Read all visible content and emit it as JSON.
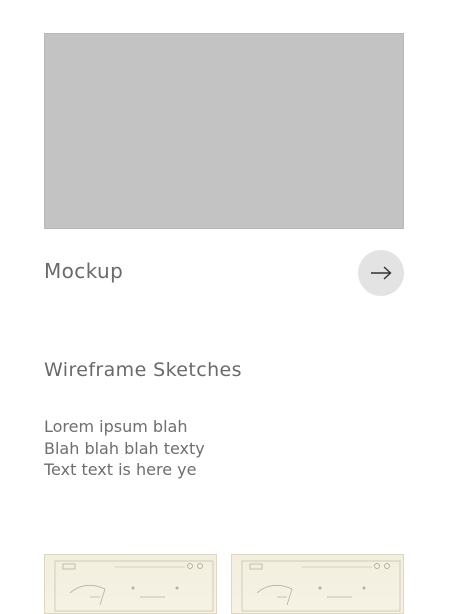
{
  "card": {
    "title": "Mockup",
    "image_color": "#c3c3c3",
    "button_icon": "arrow-right-icon"
  },
  "section": {
    "title": "Wireframe Sketches",
    "description_lines": [
      "Lorem ipsum blah",
      "Blah blah blah texty",
      "Text text is here ye"
    ]
  },
  "thumbnails": [
    {
      "alt": "wireframe sketch 1"
    },
    {
      "alt": "wireframe sketch 2"
    }
  ]
}
